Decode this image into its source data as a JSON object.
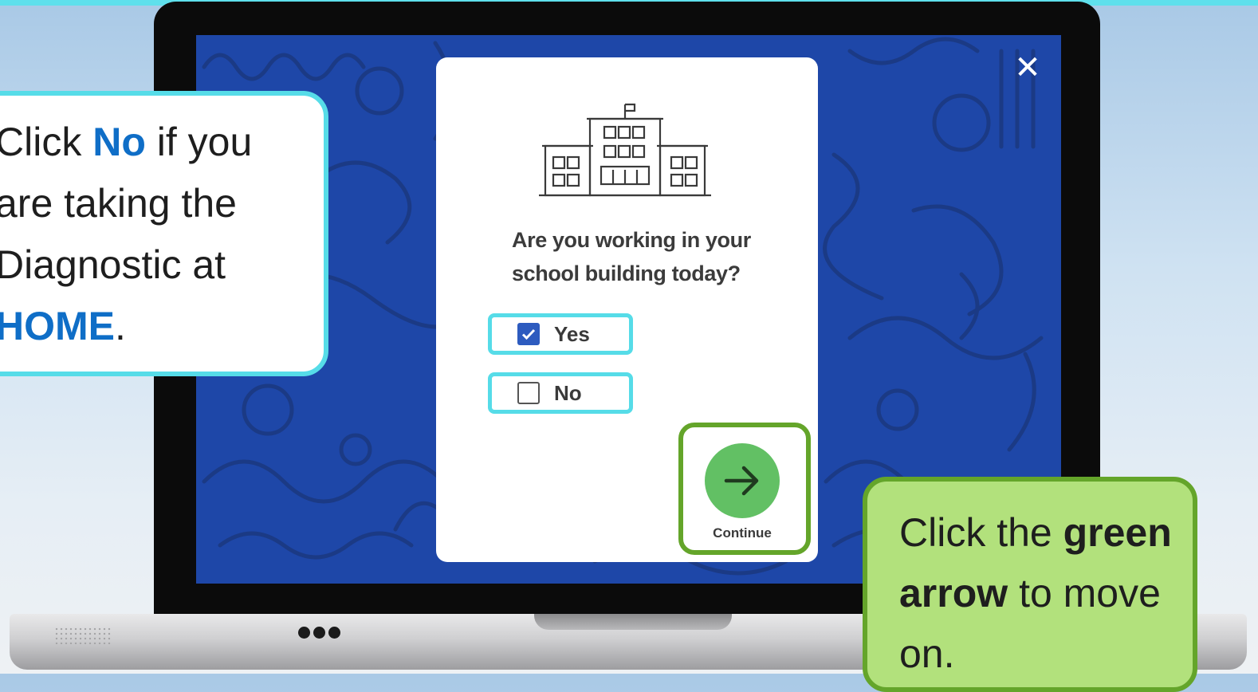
{
  "modal": {
    "close_symbol": "✕",
    "question_line1": "Are you working in your",
    "question_line2": "school building today?",
    "options": [
      {
        "label": "Yes",
        "checked": true
      },
      {
        "label": "No",
        "checked": false
      }
    ],
    "continue_label": "Continue",
    "icons": {
      "school": "school-building-icon",
      "continue": "arrow-right-icon",
      "close": "close-icon"
    }
  },
  "callout_left": {
    "part1": "Click ",
    "highlight1": "No",
    "part2": " if you are taking the Diagnostic at ",
    "highlight2": "HOME",
    "part3": "."
  },
  "callout_right": {
    "part1": "Click the ",
    "bold": "green arrow",
    "part2": " to move on."
  },
  "colors": {
    "screen_bg": "#1e47a8",
    "callout_border_cyan": "#56dce8",
    "callout_border_green": "#64a52a",
    "callout_fill_green": "#b2e17c",
    "highlight_blue": "#0f6ec7",
    "continue_button": "#62c064",
    "checkbox_checked": "#2d5bbf"
  }
}
